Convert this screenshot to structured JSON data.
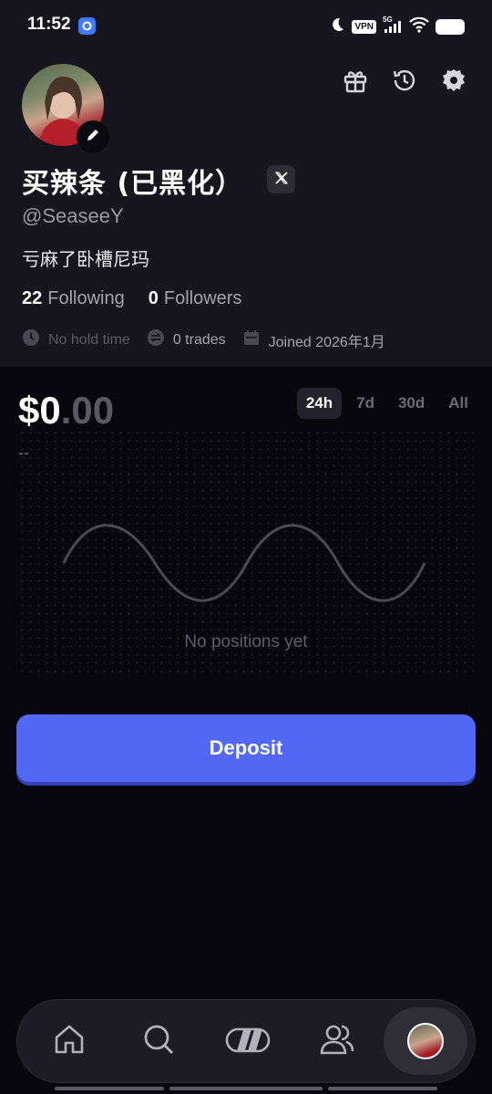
{
  "status_bar": {
    "time": "11:52",
    "vpn": "VPN",
    "network": "5G"
  },
  "profile": {
    "display_name": "买辣条 (已黑化）",
    "handle": "@SeaseeY",
    "bio": "亏麻了卧槽尼玛",
    "following_count": "22",
    "following_label": "Following",
    "followers_count": "0",
    "followers_label": "Followers",
    "hold_time": "No hold time",
    "trades": "0 trades",
    "joined": "Joined 2026年1月"
  },
  "portfolio": {
    "balance_main": "$0",
    "balance_cents": ".00",
    "change": "--",
    "ranges": [
      "24h",
      "7d",
      "30d",
      "All"
    ],
    "active_range": "24h",
    "empty_text": "No positions yet"
  },
  "deposit_label": "Deposit",
  "nav": [
    "home-icon",
    "search-icon",
    "cards-icon",
    "friends-icon",
    "profile-avatar"
  ],
  "colors": {
    "accent": "#5267f3",
    "panel": "#17151d",
    "background": "#08070e"
  }
}
